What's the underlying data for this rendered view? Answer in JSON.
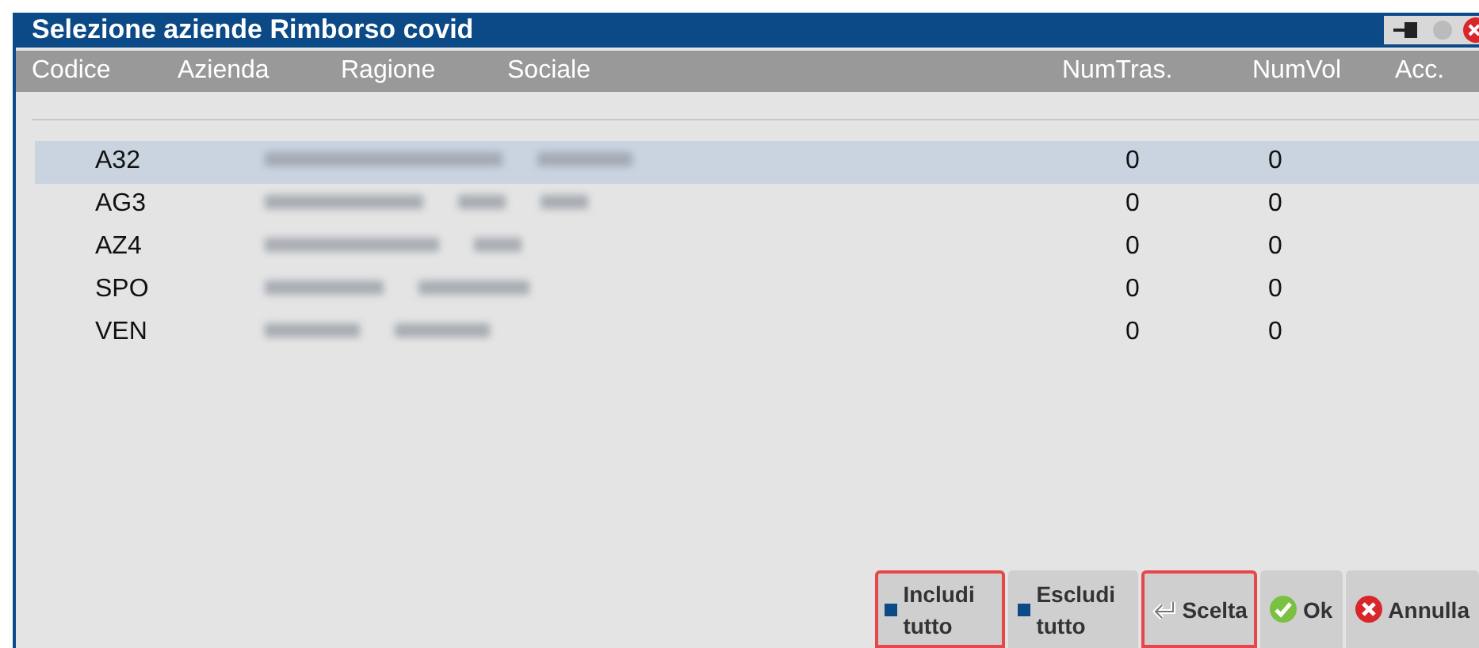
{
  "window": {
    "title": "Selezione aziende Rimborso covid"
  },
  "table": {
    "columns": [
      "Codice",
      "Azienda",
      "Ragione",
      "Sociale",
      "NumTras.",
      "NumVol",
      "Acc."
    ],
    "rows": [
      {
        "code": "A32",
        "num_tras": "0",
        "num_vol": "0",
        "selected": true
      },
      {
        "code": "AG3",
        "num_tras": "0",
        "num_vol": "0",
        "selected": false
      },
      {
        "code": "AZ4",
        "num_tras": "0",
        "num_vol": "0",
        "selected": false
      },
      {
        "code": "SPO",
        "num_tras": "0",
        "num_vol": "0",
        "selected": false
      },
      {
        "code": "VEN",
        "num_tras": "0",
        "num_vol": "0",
        "selected": false
      }
    ]
  },
  "buttons": [
    {
      "kind": "square",
      "label": "Includi tutto",
      "highlighted": true
    },
    {
      "kind": "square",
      "label": "Escludi tutto",
      "highlighted": false
    },
    {
      "kind": "enter",
      "label": "Scelta",
      "highlighted": true
    },
    {
      "kind": "ok",
      "label": "Ok",
      "highlighted": false
    },
    {
      "kind": "cancel",
      "label": "Annulla",
      "highlighted": false
    }
  ]
}
